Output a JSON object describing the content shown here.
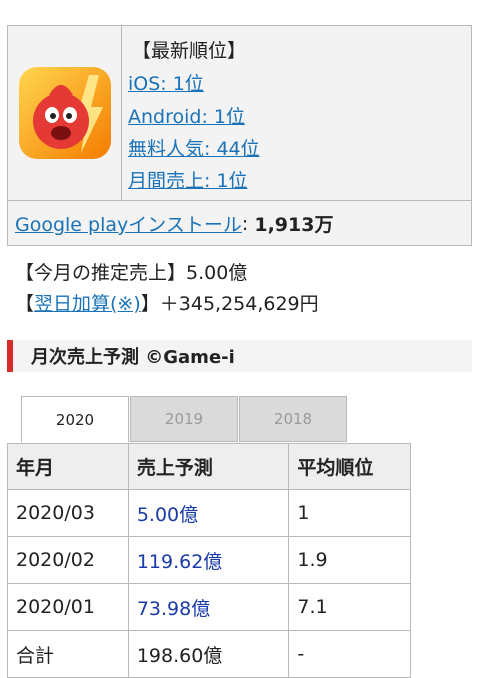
{
  "latest_rank": {
    "title": "【最新順位】",
    "links": [
      "iOS: 1位",
      "Android: 1位",
      "無料人気: 44位",
      "月間売上: 1位"
    ]
  },
  "install": {
    "label": "Google playインストール",
    "sep": ": ",
    "value": "1,913万"
  },
  "estimated_sales": "【今月の推定売上】5.00億",
  "next_day": {
    "prefix": "【",
    "link": "翌日加算(※)",
    "suffix": "】＋345,254,629円"
  },
  "section_title": "月次売上予測 ©Game-i",
  "tabs": [
    "2020",
    "2019",
    "2018"
  ],
  "table": {
    "headers": [
      "年月",
      "売上予測",
      "平均順位"
    ],
    "rows": [
      [
        "2020/03",
        "5.00億",
        "1"
      ],
      [
        "2020/02",
        "119.62億",
        "1.9"
      ],
      [
        "2020/01",
        "73.98億",
        "7.1"
      ],
      [
        "合計",
        "198.60億",
        "-"
      ]
    ]
  },
  "icon": {
    "name": "monster-strike-app-icon",
    "badge_color": "#e53935",
    "bg_color": "#f9a825"
  }
}
